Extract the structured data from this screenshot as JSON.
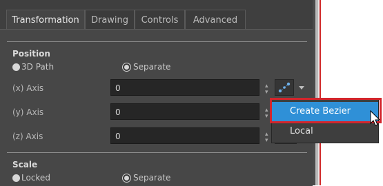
{
  "tabs": [
    {
      "label": "Transformation",
      "active": true
    },
    {
      "label": "Drawing",
      "active": false
    },
    {
      "label": "Controls",
      "active": false
    },
    {
      "label": "Advanced",
      "active": false
    }
  ],
  "position": {
    "title": "Position",
    "options": [
      {
        "label": "3D Path",
        "selected": false
      },
      {
        "label": "Separate",
        "selected": true
      }
    ],
    "axes": [
      {
        "label": "(x) Axis",
        "value": "0"
      },
      {
        "label": "(y) Axis",
        "value": "0"
      },
      {
        "label": "(z) Axis",
        "value": "0"
      }
    ]
  },
  "scale": {
    "title": "Scale",
    "options": [
      {
        "label": "Locked",
        "selected": false
      },
      {
        "label": "Separate",
        "selected": true
      }
    ]
  },
  "context_menu": {
    "items": [
      "Create Bezier",
      "Local"
    ],
    "highlighted": "Create Bezier"
  },
  "colors": {
    "highlight": "#2f90d7",
    "callout_border": "#d3252c"
  },
  "icons": {
    "function_button": "bezier-curve-icon",
    "dropdown": "chevron-down-icon",
    "cursor": "mouse-pointer-icon",
    "spin": "spin-arrows-icon"
  }
}
